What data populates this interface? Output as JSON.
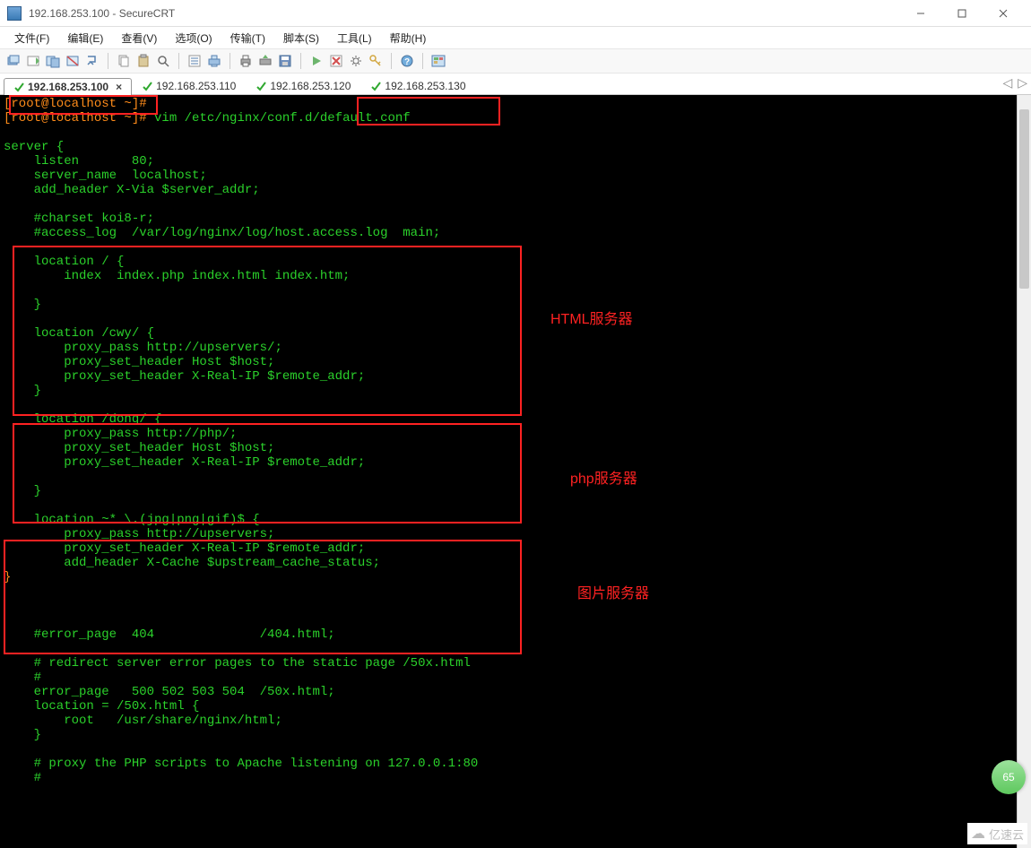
{
  "window": {
    "title": "192.168.253.100 - SecureCRT"
  },
  "menu": {
    "file": "文件(F)",
    "edit": "编辑(E)",
    "view": "查看(V)",
    "options": "选项(O)",
    "transfer": "传输(T)",
    "script": "脚本(S)",
    "tools": "工具(L)",
    "help": "帮助(H)"
  },
  "tabs": {
    "t1": "192.168.253.100",
    "t2": "192.168.253.110",
    "t3": "192.168.253.120",
    "t4": "192.168.253.130"
  },
  "terminal": {
    "prompt1": "[root@localhost ~]#",
    "prompt2": "[root@localhost ~]# ",
    "cmd": "vim /etc/nginx/conf.d/default.conf",
    "block1": "server {\n    listen       80;\n    server_name  localhost;\n    add_header X-Via $server_addr;\n\n    #charset koi8-r;\n    #access_log  /var/log/nginx/log/host.access.log  main;\n",
    "block2": "    location / {\n        index  index.php index.html index.htm;\n\n    }\n\n    location /cwy/ {\n        proxy_pass http://upservers/;\n        proxy_set_header Host $host;\n        proxy_set_header X-Real-IP $remote_addr;\n    }",
    "block3": "    location /dong/ {\n        proxy_pass http://php/;\n        proxy_set_header Host $host;\n        proxy_set_header X-Real-IP $remote_addr;\n\n    }",
    "block4": "    location ~* \\.(jpg|png|gif)$ {\n        proxy_pass http://upservers;\n        proxy_set_header X-Real-IP $remote_addr;\n        add_header X-Cache $upstream_cache_status;",
    "brace": "}",
    "block5": "    #error_page  404              /404.html;\n\n    # redirect server error pages to the static page /50x.html\n    #\n    error_page   500 502 503 504  /50x.html;\n    location = /50x.html {\n        root   /usr/share/nginx/html;\n    }\n\n    # proxy the PHP scripts to Apache listening on 127.0.0.1:80\n    #"
  },
  "annotations": {
    "a1": "HTML服务器",
    "a2": "php服务器",
    "a3": "图片服务器"
  },
  "badge": {
    "value": "65"
  },
  "watermark": {
    "text": "亿速云"
  }
}
